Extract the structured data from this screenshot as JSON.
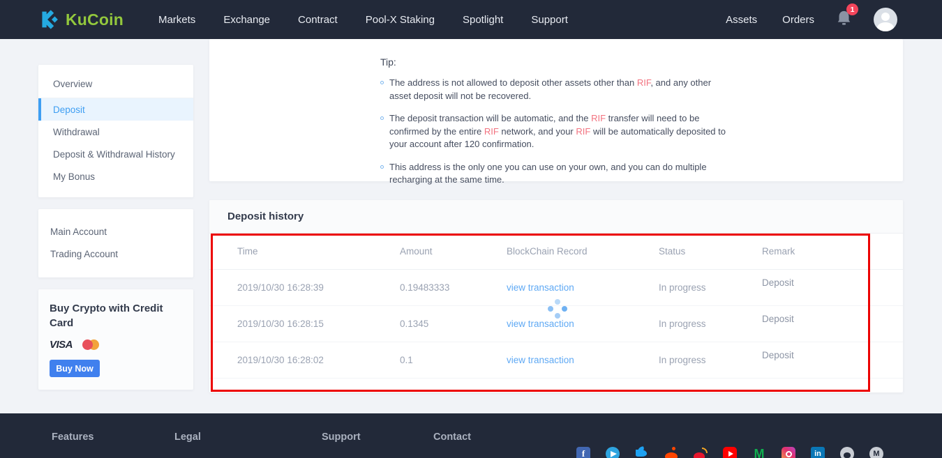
{
  "navbar": {
    "brand": "KuCoin",
    "items": [
      "Markets",
      "Exchange",
      "Contract",
      "Pool-X Staking",
      "Spotlight",
      "Support"
    ],
    "right_items": [
      "Assets",
      "Orders"
    ],
    "notification_count": "1"
  },
  "sidebar": {
    "menu": [
      {
        "label": "Overview",
        "active": false
      },
      {
        "label": "Deposit",
        "active": true
      },
      {
        "label": "Withdrawal",
        "active": false
      },
      {
        "label": "Deposit & Withdrawal History",
        "active": false
      },
      {
        "label": "My Bonus",
        "active": false
      }
    ],
    "accounts": [
      "Main Account",
      "Trading Account"
    ],
    "buy_crypto": {
      "title": "Buy Crypto with Credit Card",
      "visa_label": "VISA",
      "button_label": "Buy Now"
    }
  },
  "tip": {
    "title": "Tip:",
    "bullets": [
      [
        {
          "t": "The address is not allowed to deposit other assets other than "
        },
        {
          "t": "RIF",
          "hl": true
        },
        {
          "t": ", and any other asset deposit will not be recovered."
        }
      ],
      [
        {
          "t": "The deposit transaction will be automatic, and the "
        },
        {
          "t": "RIF",
          "hl": true
        },
        {
          "t": " transfer will need to be confirmed by the entire "
        },
        {
          "t": "RIF",
          "hl": true
        },
        {
          "t": " network, and your "
        },
        {
          "t": "RIF",
          "hl": true
        },
        {
          "t": " will be automatically deposited to your account after 120 confirmation."
        }
      ],
      [
        {
          "t": "This address is the only one you can use on your own, and you can do multiple recharging at the same time."
        }
      ]
    ]
  },
  "history": {
    "title": "Deposit history",
    "columns": [
      "Time",
      "Amount",
      "BlockChain Record",
      "Status",
      "Remark"
    ],
    "rows": [
      {
        "time": "2019/10/30 16:28:39",
        "amount": "0.19483333",
        "record": "view transaction",
        "status": "In progress",
        "remark": "Deposit"
      },
      {
        "time": "2019/10/30 16:28:15",
        "amount": "0.1345",
        "record": "view transaction",
        "status": "In progress",
        "remark": "Deposit"
      },
      {
        "time": "2019/10/30 16:28:02",
        "amount": "0.1",
        "record": "view transaction",
        "status": "In progress",
        "remark": "Deposit"
      }
    ]
  },
  "footer": {
    "columns": [
      "Features",
      "Legal",
      "Support",
      "Contact"
    ],
    "social": [
      "facebook",
      "telegram",
      "twitter",
      "reddit",
      "weibo",
      "youtube",
      "medium",
      "instagram",
      "linkedin",
      "github",
      "medium-circle"
    ]
  },
  "colors": {
    "navbar_bg": "#222939",
    "brand_blue": "#25aae1",
    "brand_green": "#93c83d",
    "accent_blue": "#3e9ef2",
    "link_blue": "#5fa9f4",
    "rif_pink": "#f2727f",
    "highlight_border_red": "#ec0000",
    "badge_red": "#f3455b",
    "buy_button_blue": "#4080ee"
  }
}
